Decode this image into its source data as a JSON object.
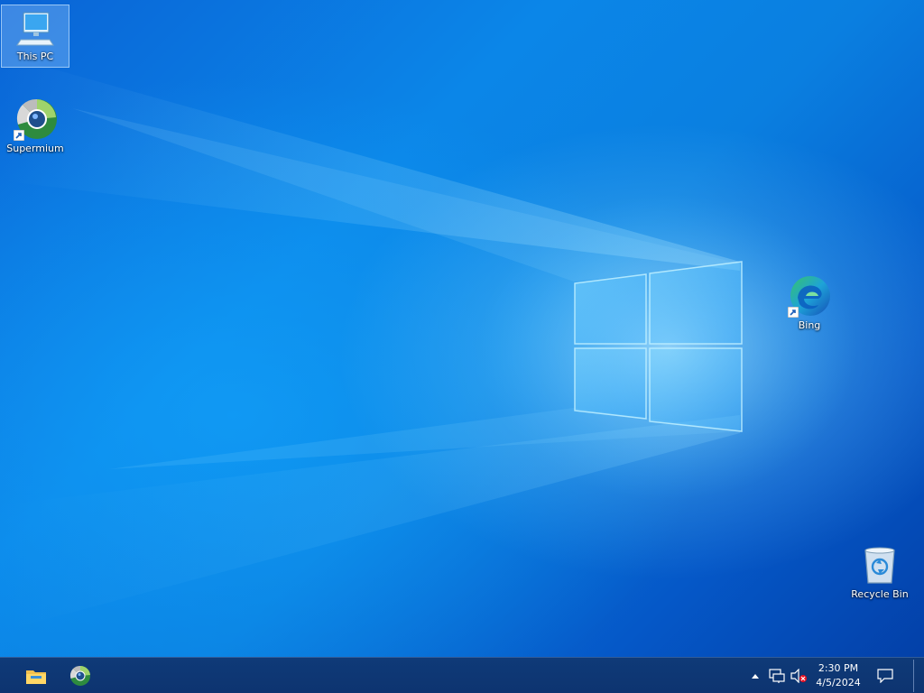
{
  "desktop": {
    "icons": {
      "this_pc": {
        "label": "This PC",
        "icon": "computer-icon",
        "selected": true
      },
      "supermium": {
        "label": "Supermium",
        "icon": "browser-icon",
        "shortcut": true
      },
      "bing": {
        "label": "Bing",
        "icon": "edge-icon",
        "shortcut": true
      },
      "recycle_bin": {
        "label": "Recycle Bin",
        "icon": "recycle-bin-icon"
      }
    },
    "wallpaper": {
      "name": "windows-10-hero",
      "colors": {
        "base": "#0a7fe0",
        "glow": "#7fd4ff",
        "deep": "#0340a8"
      }
    }
  },
  "taskbar": {
    "pinned": [
      {
        "name": "file-explorer",
        "icon": "folder-icon"
      },
      {
        "name": "supermium",
        "icon": "browser-icon"
      }
    ],
    "tray": {
      "overflow_icon": "chevron-up-icon",
      "network_icon": "network-icon",
      "volume_icon": "volume-muted-icon"
    },
    "clock": {
      "time": "2:30 PM",
      "date": "4/5/2024"
    },
    "notification_icon": "action-center-icon",
    "colors": {
      "background": "#0f3a78"
    }
  }
}
